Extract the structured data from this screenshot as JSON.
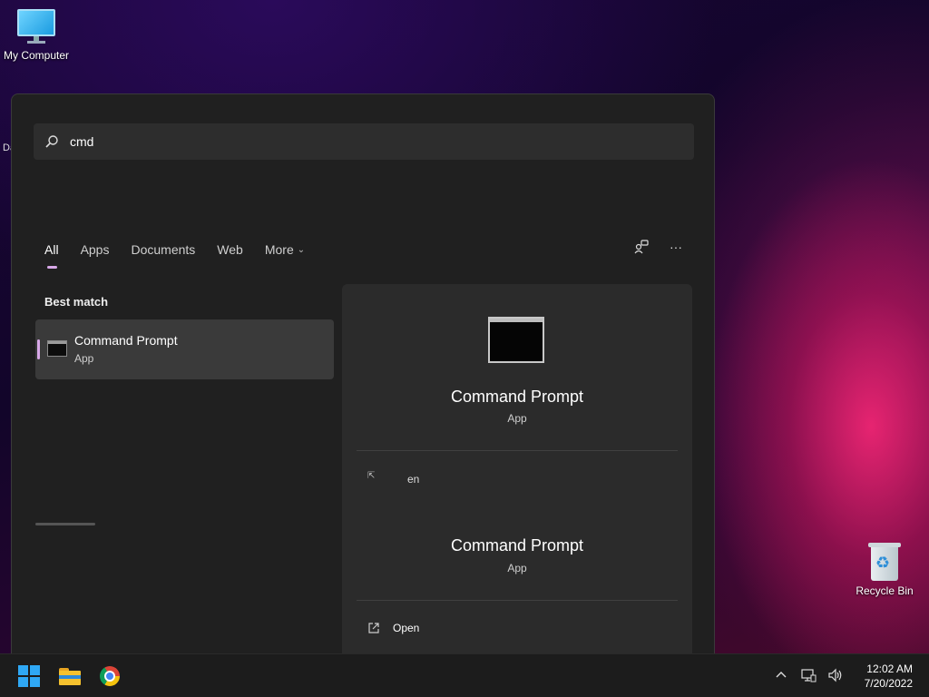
{
  "desktop": {
    "icons": [
      {
        "label": "My Computer"
      },
      {
        "label": "Recycle Bin"
      }
    ],
    "stray_label": "Da"
  },
  "search": {
    "query": "cmd"
  },
  "tabs": [
    {
      "label": "All",
      "active": true
    },
    {
      "label": "Apps"
    },
    {
      "label": "Documents"
    },
    {
      "label": "Web"
    },
    {
      "label": "More"
    }
  ],
  "toolbar": {
    "icons": [
      "feedback-icon",
      "more-options-icon"
    ]
  },
  "results": {
    "section_label": "Best match",
    "best_match": {
      "name": "Command Prompt",
      "type": "App"
    }
  },
  "detail": {
    "title": "Command Prompt",
    "subtitle": "App",
    "partial_text": "en",
    "title_repeat": "Command Prompt",
    "subtitle_repeat": "App",
    "actions": [
      {
        "label": "Open",
        "icon": "open-icon"
      }
    ]
  },
  "taskbar": {
    "apps": [
      "start-icon",
      "file-explorer-icon",
      "chrome-icon"
    ],
    "tray_icons": [
      "chevron-up-icon",
      "network-icon",
      "volume-icon"
    ],
    "time": "12:02 AM",
    "date": "7/20/2022"
  },
  "colors": {
    "accent": "#d8a8e8",
    "panel": "#202020",
    "taskbar": "#1c1c1c"
  }
}
